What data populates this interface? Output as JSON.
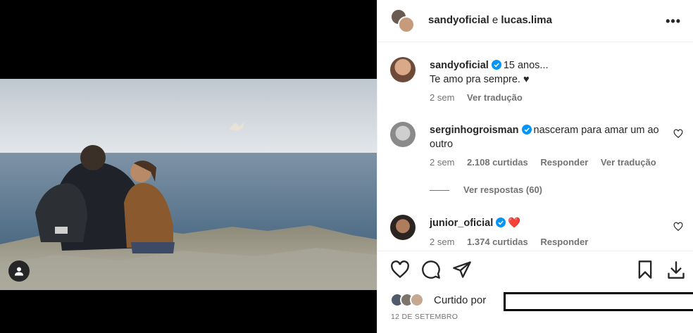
{
  "header": {
    "user1": "sandyoficial",
    "separator": "e",
    "user2": "lucas.lima",
    "more_icon": "more-horizontal-icon"
  },
  "comments": [
    {
      "username": "sandyoficial",
      "verified": true,
      "text_line1": "15 anos...",
      "text_line2": "Te amo pra sempre. ♥",
      "time": "2 sem",
      "translate": "Ver tradução"
    },
    {
      "username": "serginhogroisman",
      "verified": true,
      "text": "nasceram para amar um ao outro",
      "time": "2 sem",
      "likes": "2.108 curtidas",
      "reply": "Responder",
      "translate": "Ver tradução",
      "view_replies": "Ver respostas (60)"
    },
    {
      "username": "junior_oficial",
      "verified": true,
      "text": "❤️",
      "time": "2 sem",
      "likes": "1.374 curtidas",
      "reply": "Responder"
    }
  ],
  "likes": {
    "prefix": "Curtido por"
  },
  "date": "12 DE SETEMBRO",
  "colors": {
    "text": "#262626",
    "secondary": "#737373",
    "verified": "#0095f6",
    "heart_red": "#ed4956"
  }
}
